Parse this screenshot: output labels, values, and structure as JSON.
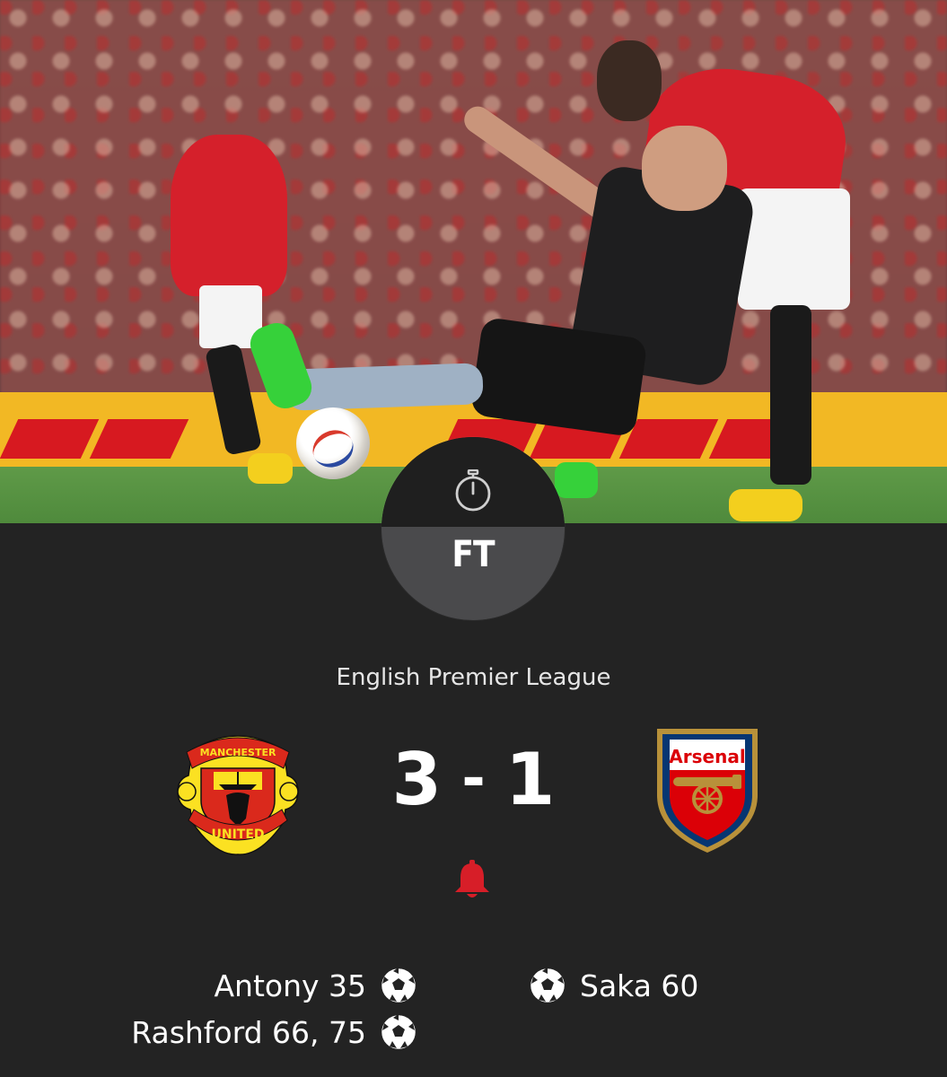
{
  "match": {
    "status": "FT",
    "competition": "English Premier League",
    "home_team": {
      "name": "Manchester United",
      "crest_text_top": "MANCHESTER",
      "crest_text_bottom": "UNITED",
      "score": "3"
    },
    "away_team": {
      "name": "Arsenal",
      "crest_text": "Arsenal",
      "score": "1"
    },
    "score_separator": "-"
  },
  "scorers": {
    "home": [
      {
        "player": "Antony 35"
      },
      {
        "player": "Rashford 66, 75"
      }
    ],
    "away": [
      {
        "player": "Saka 60"
      }
    ]
  },
  "icons": {
    "status": "stopwatch-icon",
    "notify": "bell-icon",
    "goal": "football-icon"
  },
  "colors": {
    "background": "#232323",
    "dial_top": "#1f1f1f",
    "dial_bottom": "#4a4a4c",
    "bell": "#d71e28",
    "home_red": "#da291c",
    "away_red": "#db0007",
    "away_blue": "#063672",
    "gold": "#fbe122"
  }
}
